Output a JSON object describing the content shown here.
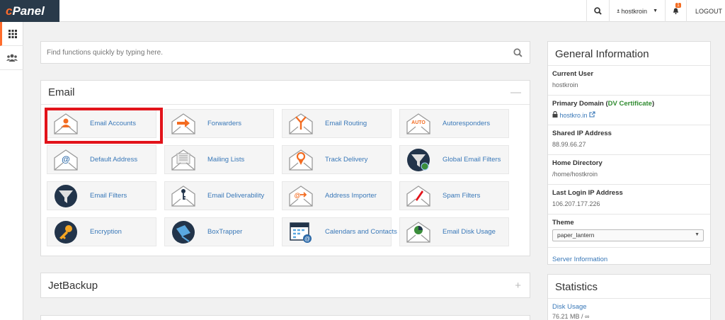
{
  "brand": {
    "logo_c": "c",
    "logo_rest": "Panel"
  },
  "topnav": {
    "username": "hostkroin",
    "notification_count": "1",
    "logout_label": "LOGOUT"
  },
  "search": {
    "placeholder": "Find functions quickly by typing here."
  },
  "email_panel": {
    "title": "Email",
    "toggle": "—",
    "items": [
      {
        "label": "Email Accounts",
        "icon": "email-accounts-icon"
      },
      {
        "label": "Forwarders",
        "icon": "forwarders-icon"
      },
      {
        "label": "Email Routing",
        "icon": "email-routing-icon"
      },
      {
        "label": "Autoresponders",
        "icon": "autoresponders-icon"
      },
      {
        "label": "Default Address",
        "icon": "default-address-icon"
      },
      {
        "label": "Mailing Lists",
        "icon": "mailing-lists-icon"
      },
      {
        "label": "Track Delivery",
        "icon": "track-delivery-icon"
      },
      {
        "label": "Global Email Filters",
        "icon": "global-email-filters-icon"
      },
      {
        "label": "Email Filters",
        "icon": "email-filters-icon"
      },
      {
        "label": "Email Deliverability",
        "icon": "email-deliverability-icon"
      },
      {
        "label": "Address Importer",
        "icon": "address-importer-icon"
      },
      {
        "label": "Spam Filters",
        "icon": "spam-filters-icon"
      },
      {
        "label": "Encryption",
        "icon": "encryption-icon"
      },
      {
        "label": "BoxTrapper",
        "icon": "boxtrapper-icon"
      },
      {
        "label": "Calendars and Contacts",
        "icon": "calendars-contacts-icon"
      },
      {
        "label": "Email Disk Usage",
        "icon": "email-disk-usage-icon"
      }
    ]
  },
  "jetbackup_panel": {
    "title": "JetBackup",
    "toggle": "+"
  },
  "general_info": {
    "title": "General Information",
    "current_user_label": "Current User",
    "current_user": "hostkroin",
    "primary_domain_label_pre": "Primary Domain (",
    "primary_domain_dv": "DV Certificate",
    "primary_domain_label_post": ")",
    "primary_domain": "hostkro.in",
    "shared_ip_label": "Shared IP Address",
    "shared_ip": "88.99.66.27",
    "home_dir_label": "Home Directory",
    "home_dir": "/home/hostkroin",
    "last_login_label": "Last Login IP Address",
    "last_login_ip": "106.207.177.226",
    "theme_label": "Theme",
    "theme_value": "paper_lantern",
    "server_info_link": "Server Information"
  },
  "statistics": {
    "title": "Statistics",
    "disk_usage_label": "Disk Usage",
    "disk_usage_value": "76.21 MB / ∞"
  },
  "colors": {
    "brand_orange": "#ff6c2c",
    "brand_dark": "#293a4a",
    "link_blue": "#3978b8",
    "highlight_red": "#e2131a"
  }
}
